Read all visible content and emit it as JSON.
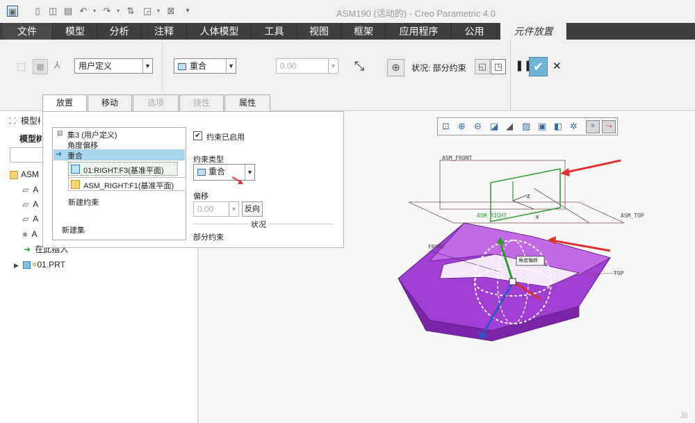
{
  "app": {
    "title": "ASM190 (活动的) - Creo Parametric 4.0"
  },
  "menu_tabs": [
    {
      "label": "文件"
    },
    {
      "label": "模型"
    },
    {
      "label": "分析"
    },
    {
      "label": "注释"
    },
    {
      "label": "人体模型"
    },
    {
      "label": "工具"
    },
    {
      "label": "视图"
    },
    {
      "label": "框架"
    },
    {
      "label": "应用程序"
    },
    {
      "label": "公用"
    },
    {
      "label": "元件放置"
    }
  ],
  "ribbon": {
    "user_defined_select": "用户定义",
    "constraint_select": "重合",
    "offset_value": "0.00",
    "status_label": "状况: 部分约束"
  },
  "sub_tabs": [
    {
      "label": "放置"
    },
    {
      "label": "移动"
    },
    {
      "label": "选项"
    },
    {
      "label": "挠性"
    },
    {
      "label": "属性"
    }
  ],
  "placement": {
    "set_label": "集3 (用户定义)",
    "angle_offset": "角度偏移",
    "coincident": "重合",
    "ref1": "01:RIGHT:F3(基准平面)",
    "ref2": "ASM_RIGHT:F1(基准平面)",
    "new_constraint": "新建约束",
    "new_set": "新建集",
    "enabled_label": "约束已启用",
    "constraint_type_label": "约束类型",
    "constraint_type_value": "重合",
    "offset_label": "偏移",
    "offset_value": "0.00",
    "flip_label": "反向",
    "status_title": "状况",
    "status_value": "部分约束"
  },
  "left_panel": {
    "header": "模型树",
    "tree_label": "模型树",
    "root": "ASM",
    "items": [
      "A",
      "A",
      "A",
      "A"
    ],
    "insert_here": "在此插入",
    "part": "01.PRT"
  },
  "viewport": {
    "labels": {
      "asm_front": "ASM_FRONT",
      "asm_top": "ASM_TOP",
      "asm_right": "ASM_RIGHT",
      "front": "FRONT",
      "top": "TOP",
      "angle_tag": "角度偏移",
      "z": "z",
      "x": "x"
    },
    "watermark": "Jil"
  },
  "colors": {
    "menubar": "#3f3f3f",
    "part": "#a13fd4",
    "accent_green": "#2e9b2e",
    "arrow_red": "#e03030"
  }
}
